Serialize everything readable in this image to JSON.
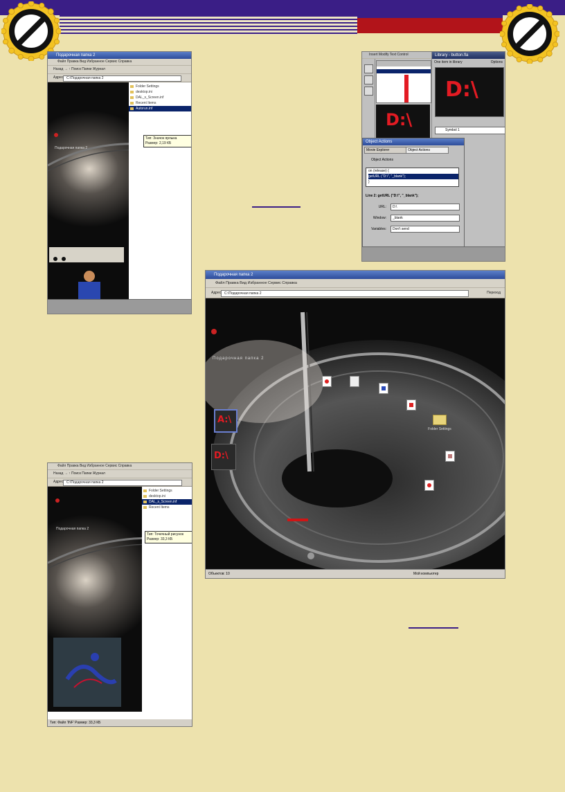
{
  "colors": {
    "page_background": "#ede2ad",
    "header_purple": "#3a1e86",
    "header_red": "#b2141a",
    "badge_gear": "#f3c323",
    "drive_label_red": "#e31b23"
  },
  "badges": {
    "left_icon": "prohibition-sign-icon",
    "right_icon": "prohibition-sign-icon"
  },
  "shot1": {
    "title": "Подарочная папка 2",
    "menu": "Файл  Правка  Вид  Избранное  Сервис  Справка",
    "toolbar": "Назад  →  ↑  Поиск  Папки  Журнал",
    "address_label": "Адрес",
    "address_value": "C:\\Подарочная папка 2",
    "folder_title": "Подарочная папка 2",
    "files": [
      "Folder Settings",
      "desktop.ini",
      "DAL_s_Screen.inf",
      "Recent Items",
      "Autorun.inf"
    ],
    "tooltip_line1": "Тип: Значок ярлыка",
    "tooltip_line2": "Размер: 2,19 КБ"
  },
  "shot2": {
    "menu": "Insert  Modify  Text  Control",
    "library_title": "Library - button.fla",
    "library_sub": "One item in library",
    "library_options": "Options",
    "drive_label": "D:\\",
    "symbol_name": "Symbol 1",
    "actions_title": "Object Actions",
    "actions_tab1": "Movie Explorer",
    "actions_tab2": "Object Actions",
    "actions_header": "Object Actions",
    "code_line1": "on (release) {",
    "code_line2": "getURL (\"D:\\\", \"_blank\");",
    "code_line3": "}",
    "line_info": "Line 2: getURL (\"D:\\\", \"_blank\");",
    "param_url_label": "URL:",
    "param_url_value": "D:\\",
    "param_window_label": "Window:",
    "param_window_value": "_blank",
    "param_vars_label": "Variables:",
    "param_vars_value": "Don't send"
  },
  "shot3": {
    "title": "Подарочная папка 2",
    "menu": "Файл  Правка  Вид  Избранное  Сервис  Справка",
    "address_label": "Адрес",
    "address_value": "C:\\Подарочная папка 2",
    "goto_label": "Переход",
    "folder_title": "Подарочная папка 2",
    "drive_a": "A:\\",
    "drive_d": "D:\\",
    "folder_label": "Folder Settings",
    "status_left": "Объектов: 10",
    "status_right": "Мой компьютер"
  },
  "shot4": {
    "menu": "Файл  Правка  Вид  Избранное  Сервис  Справка",
    "toolbar": "Назад  →  ↑  Поиск  Папки  Журнал",
    "address_label": "Адрес",
    "address_value": "C:\\Подарочная папка 2",
    "folder_title": "Подарочная папка 2",
    "files": [
      "Folder Settings",
      "desktop.ini",
      "DAL_s_Screen.inf",
      "Recent Items"
    ],
    "tooltip_line1": "Тип: Точечный рисунок",
    "tooltip_line2": "Размер: 33,3 КБ",
    "status": "Тип: Файл 'INF' Размер: 33,3 КБ"
  }
}
